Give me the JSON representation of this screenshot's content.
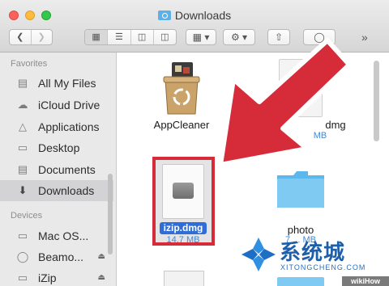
{
  "window": {
    "title": "Downloads",
    "toolbar_more": "»"
  },
  "sidebar": {
    "favorites_header": "Favorites",
    "favorites": [
      {
        "label": "All My Files",
        "icon": "all-files-icon"
      },
      {
        "label": "iCloud Drive",
        "icon": "cloud-icon"
      },
      {
        "label": "Applications",
        "icon": "applications-icon"
      },
      {
        "label": "Desktop",
        "icon": "desktop-icon"
      },
      {
        "label": "Documents",
        "icon": "documents-icon"
      },
      {
        "label": "Downloads",
        "icon": "downloads-icon",
        "selected": true
      }
    ],
    "devices_header": "Devices",
    "devices": [
      {
        "label": "Mac OS...",
        "icon": "disk-icon"
      },
      {
        "label": "Beamo...",
        "icon": "disk-icon",
        "eject": true
      },
      {
        "label": "iZip",
        "icon": "disk-icon",
        "eject": true
      }
    ]
  },
  "files": {
    "appcleaner": {
      "name": "AppCleaner"
    },
    "partial_dmg": {
      "name": "dmg",
      "size": "MB"
    },
    "izip": {
      "name": "izip.dmg",
      "size": "14.7 MB",
      "highlight_color": "#d62c3a"
    },
    "photo": {
      "name": "photo",
      "size": "7 ... MB"
    }
  },
  "watermark": {
    "chinese": "系统城",
    "latin": "XITONGCHENG.COM",
    "wikihow": "wikiHow"
  },
  "colors": {
    "arrow": "#d62c3a",
    "folder": "#6fc1f0",
    "selection": "#d3d3d6"
  }
}
